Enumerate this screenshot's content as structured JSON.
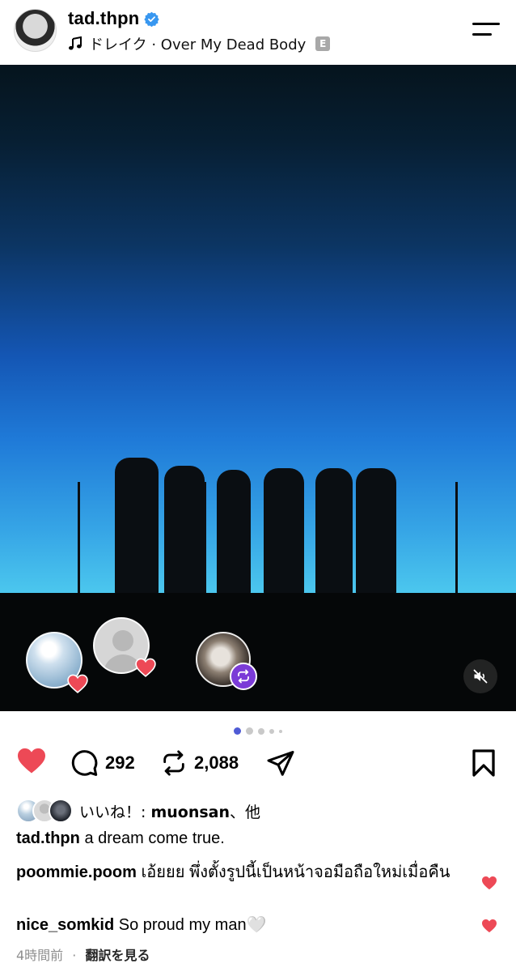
{
  "header": {
    "username": "tad.thpn",
    "verified": true,
    "music_label": "ドレイク · Over My Dead Body",
    "explicit_badge": "E"
  },
  "media": {
    "carousel_count": 5,
    "carousel_active": 0
  },
  "actions": {
    "liked": true,
    "comments_count": "292",
    "reposts_count": "2,088"
  },
  "likes": {
    "prefix": "いいね！: ",
    "user": "muonsan",
    "suffix": "、他"
  },
  "caption": {
    "user": "tad.thpn",
    "text": "a dream come true."
  },
  "comments": [
    {
      "user": "poommie.poom",
      "text": "เอ้ยยย พึ่งตั้งรูปนี้เป็นหน้าจอมือถือใหม่เมื่อคืน"
    },
    {
      "user": "nice_somkid",
      "text": "So proud my man🤍"
    }
  ],
  "meta": {
    "time": "4時間前",
    "separator": "·",
    "translate": "翻訳を見る"
  },
  "colors": {
    "heart": "#ed4956",
    "verified": "#3897f0",
    "repost_badge": "#7b3bd7",
    "dot_active": "#4f5bd5"
  }
}
